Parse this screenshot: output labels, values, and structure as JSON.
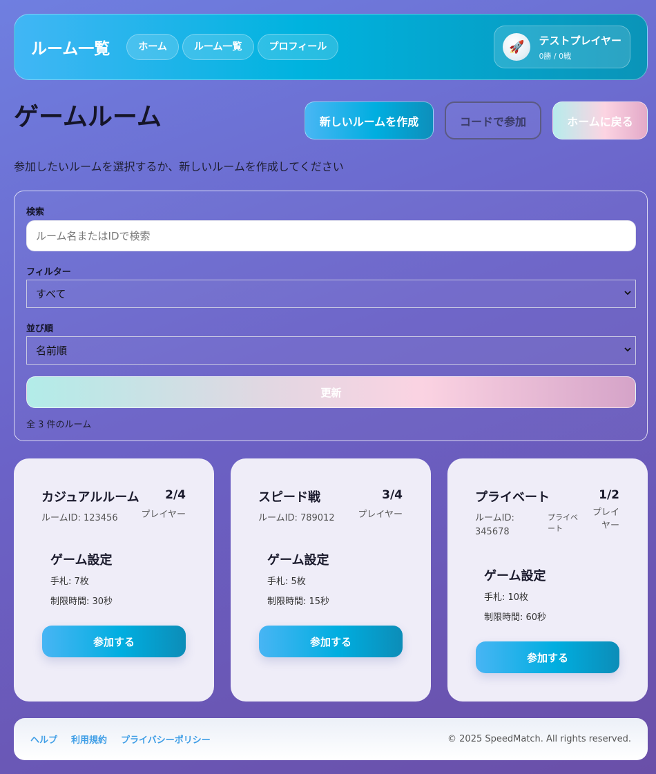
{
  "header": {
    "logo": "ルーム一覧",
    "nav": [
      "ホーム",
      "ルーム一覧",
      "プロフィール"
    ],
    "user": {
      "avatar_icon": "rocket-icon",
      "avatar_glyph": "🚀",
      "name": "テストプレイヤー",
      "record": "0勝 / 0戦"
    }
  },
  "page": {
    "title": "ゲームルーム",
    "create_label": "新しいルームを作成",
    "join_code_label": "コードで参加",
    "home_label": "ホームに戻る",
    "subtitle": "参加したいルームを選択するか、新しいルームを作成してください"
  },
  "filters": {
    "search_label": "検索",
    "search_placeholder": "ルーム名またはIDで検索",
    "filter_label": "フィルター",
    "filter_value": "すべて",
    "sort_label": "並び順",
    "sort_value": "名前順",
    "refresh_label": "更新",
    "count_text": "全 3 件のルーム"
  },
  "rooms": [
    {
      "name": "カジュアルルーム",
      "id_text": "ルームID: 123456",
      "players": "2/4",
      "players_label": "プレイヤー",
      "settings_title": "ゲーム設定",
      "hand": "手札: 7枚",
      "time": "制限時間: 30秒",
      "join_label": "参加する"
    },
    {
      "name": "スピード戦",
      "id_text": "ルームID: 789012",
      "players": "3/4",
      "players_label": "プレイヤー",
      "settings_title": "ゲーム設定",
      "hand": "手札: 5枚",
      "time": "制限時間: 15秒",
      "join_label": "参加する"
    },
    {
      "name": "プライベート",
      "id_line1": "ルームID:",
      "id_line2": "345678",
      "badge": "プライベート",
      "players": "1/2",
      "players_label": "プレイヤー",
      "settings_title": "ゲーム設定",
      "hand": "手札: 10枚",
      "time": "制限時間: 60秒",
      "join_label": "参加する"
    }
  ],
  "footer": {
    "links": [
      "ヘルプ",
      "利用規約",
      "プライバシーポリシー"
    ],
    "copyright": "© 2025 SpeedMatch. All rights reserved."
  },
  "colors": {
    "accent": "#00aee0",
    "link": "#3f9ee6"
  }
}
